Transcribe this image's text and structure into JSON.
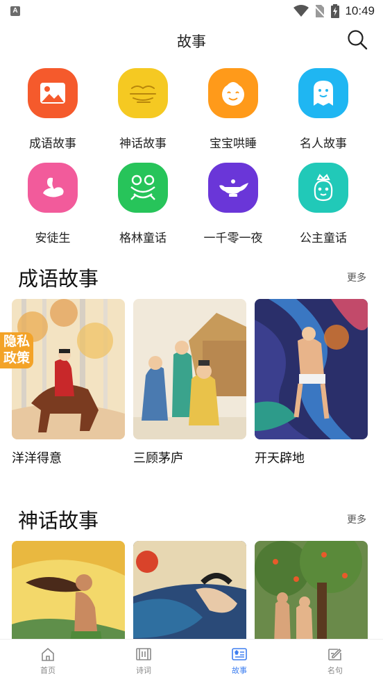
{
  "status": {
    "time": "10:49",
    "app_badge": "A"
  },
  "header": {
    "title": "故事"
  },
  "categories": [
    {
      "label": "成语故事",
      "icon": "picture-icon",
      "color": "#f55a2c"
    },
    {
      "label": "神话故事",
      "icon": "cloud-icon",
      "color": "#f5c922"
    },
    {
      "label": "宝宝哄睡",
      "icon": "baby-face-icon",
      "color": "#ff9a1a"
    },
    {
      "label": "名人故事",
      "icon": "ghost-icon",
      "color": "#1fb6f2"
    },
    {
      "label": "安徒生",
      "icon": "swan-icon",
      "color": "#f25b9b"
    },
    {
      "label": "格林童话",
      "icon": "frog-icon",
      "color": "#27c45a"
    },
    {
      "label": "一千零一夜",
      "icon": "magic-lamp-icon",
      "color": "#6a36d8"
    },
    {
      "label": "公主童话",
      "icon": "princess-icon",
      "color": "#21c9b8"
    }
  ],
  "sections": [
    {
      "title": "成语故事",
      "more": "更多",
      "cards": [
        {
          "title": "洋洋得意"
        },
        {
          "title": "三顾茅庐"
        },
        {
          "title": "开天辟地"
        }
      ]
    },
    {
      "title": "神话故事",
      "more": "更多",
      "cards": [
        {
          "title": ""
        },
        {
          "title": ""
        },
        {
          "title": ""
        }
      ]
    }
  ],
  "privacy_badge": {
    "line1": "隐私",
    "line2": "政策"
  },
  "tabs": [
    {
      "label": "首页",
      "icon": "home-icon"
    },
    {
      "label": "诗词",
      "icon": "scroll-icon"
    },
    {
      "label": "故事",
      "icon": "story-book-icon",
      "active": true
    },
    {
      "label": "名句",
      "icon": "edit-note-icon"
    }
  ]
}
